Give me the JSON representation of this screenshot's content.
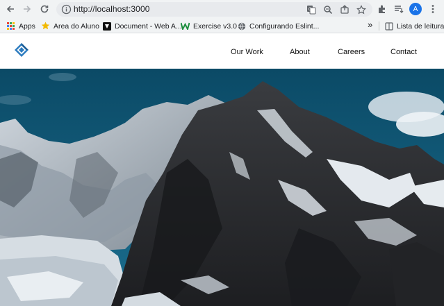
{
  "browser": {
    "url": "http://localhost:3000",
    "profile_initial": "A",
    "icons": {
      "back": "back-arrow-icon",
      "forward": "forward-arrow-icon",
      "reload": "reload-icon",
      "site_info": "info-icon",
      "translate": "translate-icon",
      "zoom": "zoom-icon",
      "share": "share-icon",
      "bookmark": "star-icon",
      "extensions": "puzzle-icon",
      "reading_queue": "reading-list-icon",
      "menu": "kebab-menu-icon"
    }
  },
  "bookmarks": {
    "items": [
      {
        "label": "Apps",
        "icon": "apps-grid-icon"
      },
      {
        "label": "Area do Aluno",
        "icon": "star-badge-icon"
      },
      {
        "label": "Document - Web A...",
        "icon": "document-icon"
      },
      {
        "label": "Exercise v3.0",
        "icon": "w-logo-icon"
      },
      {
        "label": "Configurando Eslint...",
        "icon": "globe-icon"
      }
    ],
    "overflow": "»",
    "reading_list": "Lista de leitura"
  },
  "site": {
    "logo": "diamond-logo-icon",
    "nav": [
      {
        "label": "Our Work"
      },
      {
        "label": "About"
      },
      {
        "label": "Careers"
      },
      {
        "label": "Contact"
      }
    ]
  },
  "hero": {
    "image": "snowy-mountain-peaks",
    "colors": {
      "sky": "#0f5673",
      "rock": "#2a2b2e",
      "snow": "#e8edf2"
    }
  }
}
